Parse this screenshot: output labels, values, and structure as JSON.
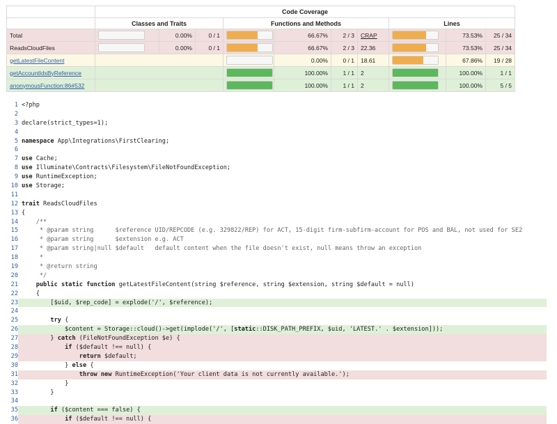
{
  "header": {
    "group_title": "Code Coverage",
    "classes_traits": "Classes and Traits",
    "functions_methods": "Functions and Methods",
    "lines": "Lines"
  },
  "colors": {
    "danger": "#f2dede",
    "warning": "#fcf8e3",
    "success": "#dff0d8",
    "bar_orange": "#f0ad4e",
    "bar_green": "#5cb85c",
    "link": "#2f5ea7"
  },
  "rows": [
    {
      "name": "Total",
      "link": false,
      "status": "danger",
      "classes_pct": "0.00%",
      "classes_count": "0 / 1",
      "classes_fill": 0,
      "methods_fill": 0.6667,
      "methods_color": "orange",
      "methods_pct": "66.67%",
      "methods_count": "2 / 3",
      "crap": "CRAP",
      "lines_fill": 0.7353,
      "lines_color": "orange",
      "lines_pct": "73.53%",
      "lines_count": "25 / 34"
    },
    {
      "name": "ReadsCloudFiles",
      "link": false,
      "status": "danger",
      "classes_pct": "0.00%",
      "classes_count": "0 / 1",
      "classes_fill": 0,
      "methods_fill": 0.6667,
      "methods_color": "orange",
      "methods_pct": "66.67%",
      "methods_count": "2 / 3",
      "crap": "22.36",
      "lines_fill": 0.7353,
      "lines_color": "orange",
      "lines_pct": "73.53%",
      "lines_count": "25 / 34"
    },
    {
      "name": "getLatestFileContent",
      "link": true,
      "status": "warning",
      "methods_fill": 0,
      "methods_color": "orange",
      "methods_pct": "0.00%",
      "methods_count": "0 / 1",
      "crap": "18.61",
      "lines_fill": 0.6786,
      "lines_color": "orange",
      "lines_pct": "67.86%",
      "lines_count": "19 / 28"
    },
    {
      "name": "getAccountIdsByReference",
      "link": true,
      "status": "success",
      "methods_fill": 1,
      "methods_color": "green",
      "methods_pct": "100.00%",
      "methods_count": "1 / 1",
      "crap": "2",
      "lines_fill": 1,
      "lines_color": "green",
      "lines_pct": "100.00%",
      "lines_count": "1 / 1"
    },
    {
      "name": "anonymousFunction:86#532",
      "link": true,
      "status": "success",
      "methods_fill": 1,
      "methods_color": "green",
      "methods_pct": "100.00%",
      "methods_count": "1 / 1",
      "crap": "2",
      "lines_fill": 1,
      "lines_color": "green",
      "lines_pct": "100.00%",
      "lines_count": "5 / 5"
    }
  ],
  "code_lines": [
    {
      "n": "1",
      "text": "<?php",
      "cov": ""
    },
    {
      "n": "2",
      "text": "",
      "cov": ""
    },
    {
      "n": "3",
      "text": "declare(strict_types=1);",
      "cov": ""
    },
    {
      "n": "4",
      "text": "",
      "cov": ""
    },
    {
      "n": "5",
      "text": "namespace App\\Integrations\\FirstClearing;",
      "cov": ""
    },
    {
      "n": "6",
      "text": "",
      "cov": ""
    },
    {
      "n": "7",
      "text": "use Cache;",
      "cov": ""
    },
    {
      "n": "8",
      "text": "use Illuminate\\Contracts\\Filesystem\\FileNotFoundException;",
      "cov": ""
    },
    {
      "n": "9",
      "text": "use RuntimeException;",
      "cov": ""
    },
    {
      "n": "10",
      "text": "use Storage;",
      "cov": ""
    },
    {
      "n": "11",
      "text": "",
      "cov": ""
    },
    {
      "n": "12",
      "text": "trait ReadsCloudFiles",
      "cov": ""
    },
    {
      "n": "13",
      "text": "{",
      "cov": ""
    },
    {
      "n": "14",
      "text": "    /**",
      "cov": ""
    },
    {
      "n": "15",
      "text": "     * @param string      $reference UID/REPCODE (e.g. 329822/REP) for ACT, 15-digit firm-subfirm-account for POS and BAL, not used for SE2",
      "cov": ""
    },
    {
      "n": "16",
      "text": "     * @param string      $extension e.g. ACT",
      "cov": ""
    },
    {
      "n": "17",
      "text": "     * @param string|null $default   default content when the file doesn't exist, null means throw an exception",
      "cov": ""
    },
    {
      "n": "18",
      "text": "     *",
      "cov": ""
    },
    {
      "n": "19",
      "text": "     * @return string",
      "cov": ""
    },
    {
      "n": "20",
      "text": "     */",
      "cov": ""
    },
    {
      "n": "21",
      "text": "    public static function getLatestFileContent(string $reference, string $extension, string $default = null)",
      "cov": ""
    },
    {
      "n": "22",
      "text": "    {",
      "cov": ""
    },
    {
      "n": "23",
      "text": "        [$uid, $rep_code] = explode('/', $reference);",
      "cov": "covered"
    },
    {
      "n": "24",
      "text": "",
      "cov": ""
    },
    {
      "n": "25",
      "text": "        try {",
      "cov": ""
    },
    {
      "n": "26",
      "text": "            $content = Storage::cloud()->get(implode('/', [static::DISK_PATH_PREFIX, $uid, 'LATEST.' . $extension]));",
      "cov": "covered"
    },
    {
      "n": "27",
      "text": "        } catch (FileNotFoundException $e) {",
      "cov": "uncovered"
    },
    {
      "n": "28",
      "text": "            if ($default !== null) {",
      "cov": "uncovered"
    },
    {
      "n": "29",
      "text": "                return $default;",
      "cov": "uncovered"
    },
    {
      "n": "30",
      "text": "            } else {",
      "cov": ""
    },
    {
      "n": "31",
      "text": "                throw new RuntimeException('Your client data is not currently available.');",
      "cov": "uncovered"
    },
    {
      "n": "32",
      "text": "            }",
      "cov": ""
    },
    {
      "n": "33",
      "text": "        }",
      "cov": ""
    },
    {
      "n": "34",
      "text": "",
      "cov": ""
    },
    {
      "n": "35",
      "text": "        if ($content === false) {",
      "cov": "covered"
    },
    {
      "n": "36",
      "text": "            if ($default !== null) {",
      "cov": "uncovered"
    }
  ]
}
